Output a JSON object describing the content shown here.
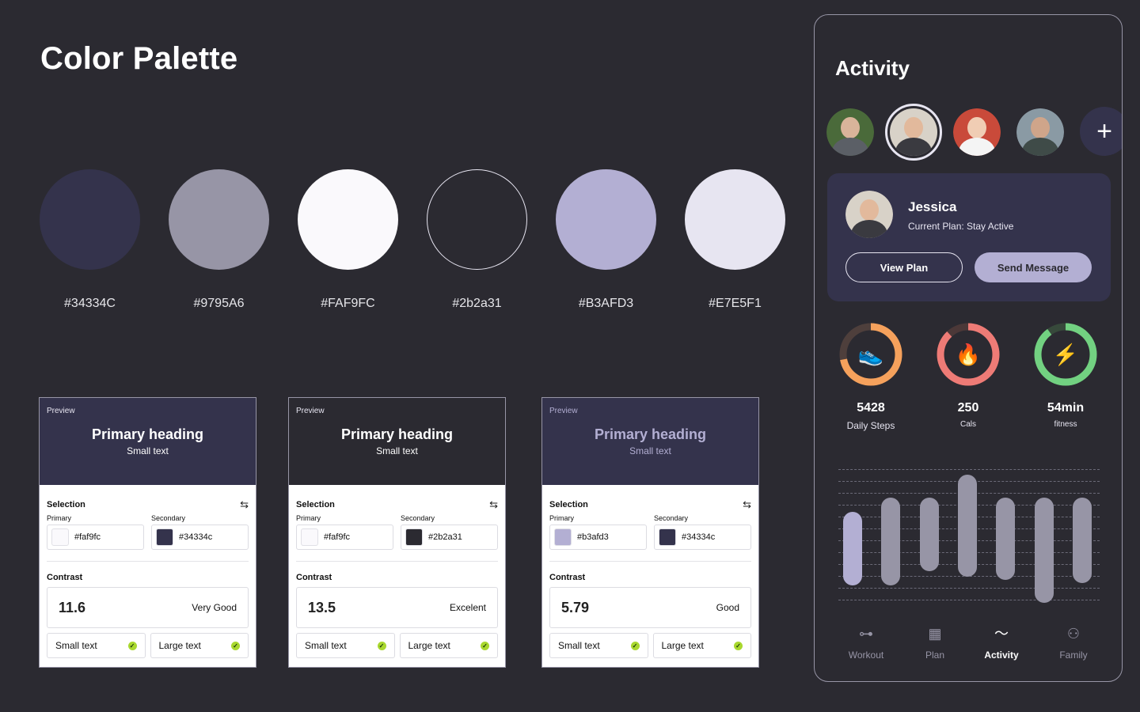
{
  "title": "Color Palette",
  "swatches": [
    {
      "hex": "#34334C",
      "color": "#34334c"
    },
    {
      "hex": "#9795A6",
      "color": "#9795a6"
    },
    {
      "hex": "#FAF9FC",
      "color": "#faf9fc"
    },
    {
      "hex": "#2b2a31",
      "color": "#2b2a31"
    },
    {
      "hex": "#B3AFD3",
      "color": "#b3afd3"
    },
    {
      "hex": "#E7E5F1",
      "color": "#e7e5f1"
    }
  ],
  "previews": [
    {
      "label": "Preview",
      "heading": "Primary heading",
      "small": "Small text",
      "top_bg": "#34334c",
      "heading_color": "#ffffff",
      "selection": "Selection",
      "primary_label": "Primary",
      "secondary_label": "Secondary",
      "primary_value": "#faf9fc",
      "primary_chip": "#faf9fc",
      "secondary_value": "#34334c",
      "secondary_chip": "#34334c",
      "contrast_label": "Contrast",
      "contrast": "11.6",
      "rating": "Very Good",
      "small_check": "Small text",
      "large_check": "Large text"
    },
    {
      "label": "Preview",
      "heading": "Primary heading",
      "small": "Small text",
      "top_bg": "#2b2a31",
      "heading_color": "#ffffff",
      "selection": "Selection",
      "primary_label": "Primary",
      "secondary_label": "Secondary",
      "primary_value": "#faf9fc",
      "primary_chip": "#faf9fc",
      "secondary_value": "#2b2a31",
      "secondary_chip": "#2b2a31",
      "contrast_label": "Contrast",
      "contrast": "13.5",
      "rating": "Excelent",
      "small_check": "Small text",
      "large_check": "Large text"
    },
    {
      "label": "Preview",
      "heading": "Primary heading",
      "small": "Small text",
      "top_bg": "#34334c",
      "heading_color": "#b3afd3",
      "selection": "Selection",
      "primary_label": "Primary",
      "secondary_label": "Secondary",
      "primary_value": "#b3afd3",
      "primary_chip": "#b3afd3",
      "secondary_value": "#34334c",
      "secondary_chip": "#34334c",
      "contrast_label": "Contrast",
      "contrast": "5.79",
      "rating": "Good",
      "small_check": "Small text",
      "large_check": "Large text"
    }
  ],
  "activity": {
    "title": "Activity",
    "profile": {
      "name": "Jessica",
      "plan": "Current Plan: Stay Active",
      "view_plan": "View Plan",
      "send_message": "Send Message"
    },
    "stats": [
      {
        "value": "5428",
        "label": "Daily Steps",
        "icon": "sneaker-icon",
        "color": "#f5a15c",
        "track": "#4e3f3c",
        "progress": 0.72
      },
      {
        "value": "250",
        "label": "Cals",
        "icon": "flame-icon",
        "color": "#ee7b76",
        "track": "#4b3838",
        "progress": 0.88
      },
      {
        "value": "54min",
        "label": "fitness",
        "icon": "dumbbell-icon",
        "color": "#72d181",
        "track": "#37493b",
        "progress": 0.9
      }
    ],
    "bars": [
      {
        "start": 0.32,
        "end": 0.84,
        "color": "#b3afd3"
      },
      {
        "start": 0.22,
        "end": 0.84,
        "color": "#9795a6"
      },
      {
        "start": 0.22,
        "end": 0.74,
        "color": "#9795a6"
      },
      {
        "start": 0.06,
        "end": 0.78,
        "color": "#9795a6"
      },
      {
        "start": 0.22,
        "end": 0.8,
        "color": "#9795a6"
      },
      {
        "start": 0.22,
        "end": 0.96,
        "color": "#9795a6"
      },
      {
        "start": 0.22,
        "end": 0.82,
        "color": "#9795a6"
      }
    ],
    "tabs": [
      {
        "label": "Workout",
        "icon": "dumbbell-icon"
      },
      {
        "label": "Plan",
        "icon": "calendar-icon"
      },
      {
        "label": "Activity",
        "icon": "pulse-icon"
      },
      {
        "label": "Family",
        "icon": "people-icon"
      }
    ],
    "active_tab": "Activity"
  }
}
